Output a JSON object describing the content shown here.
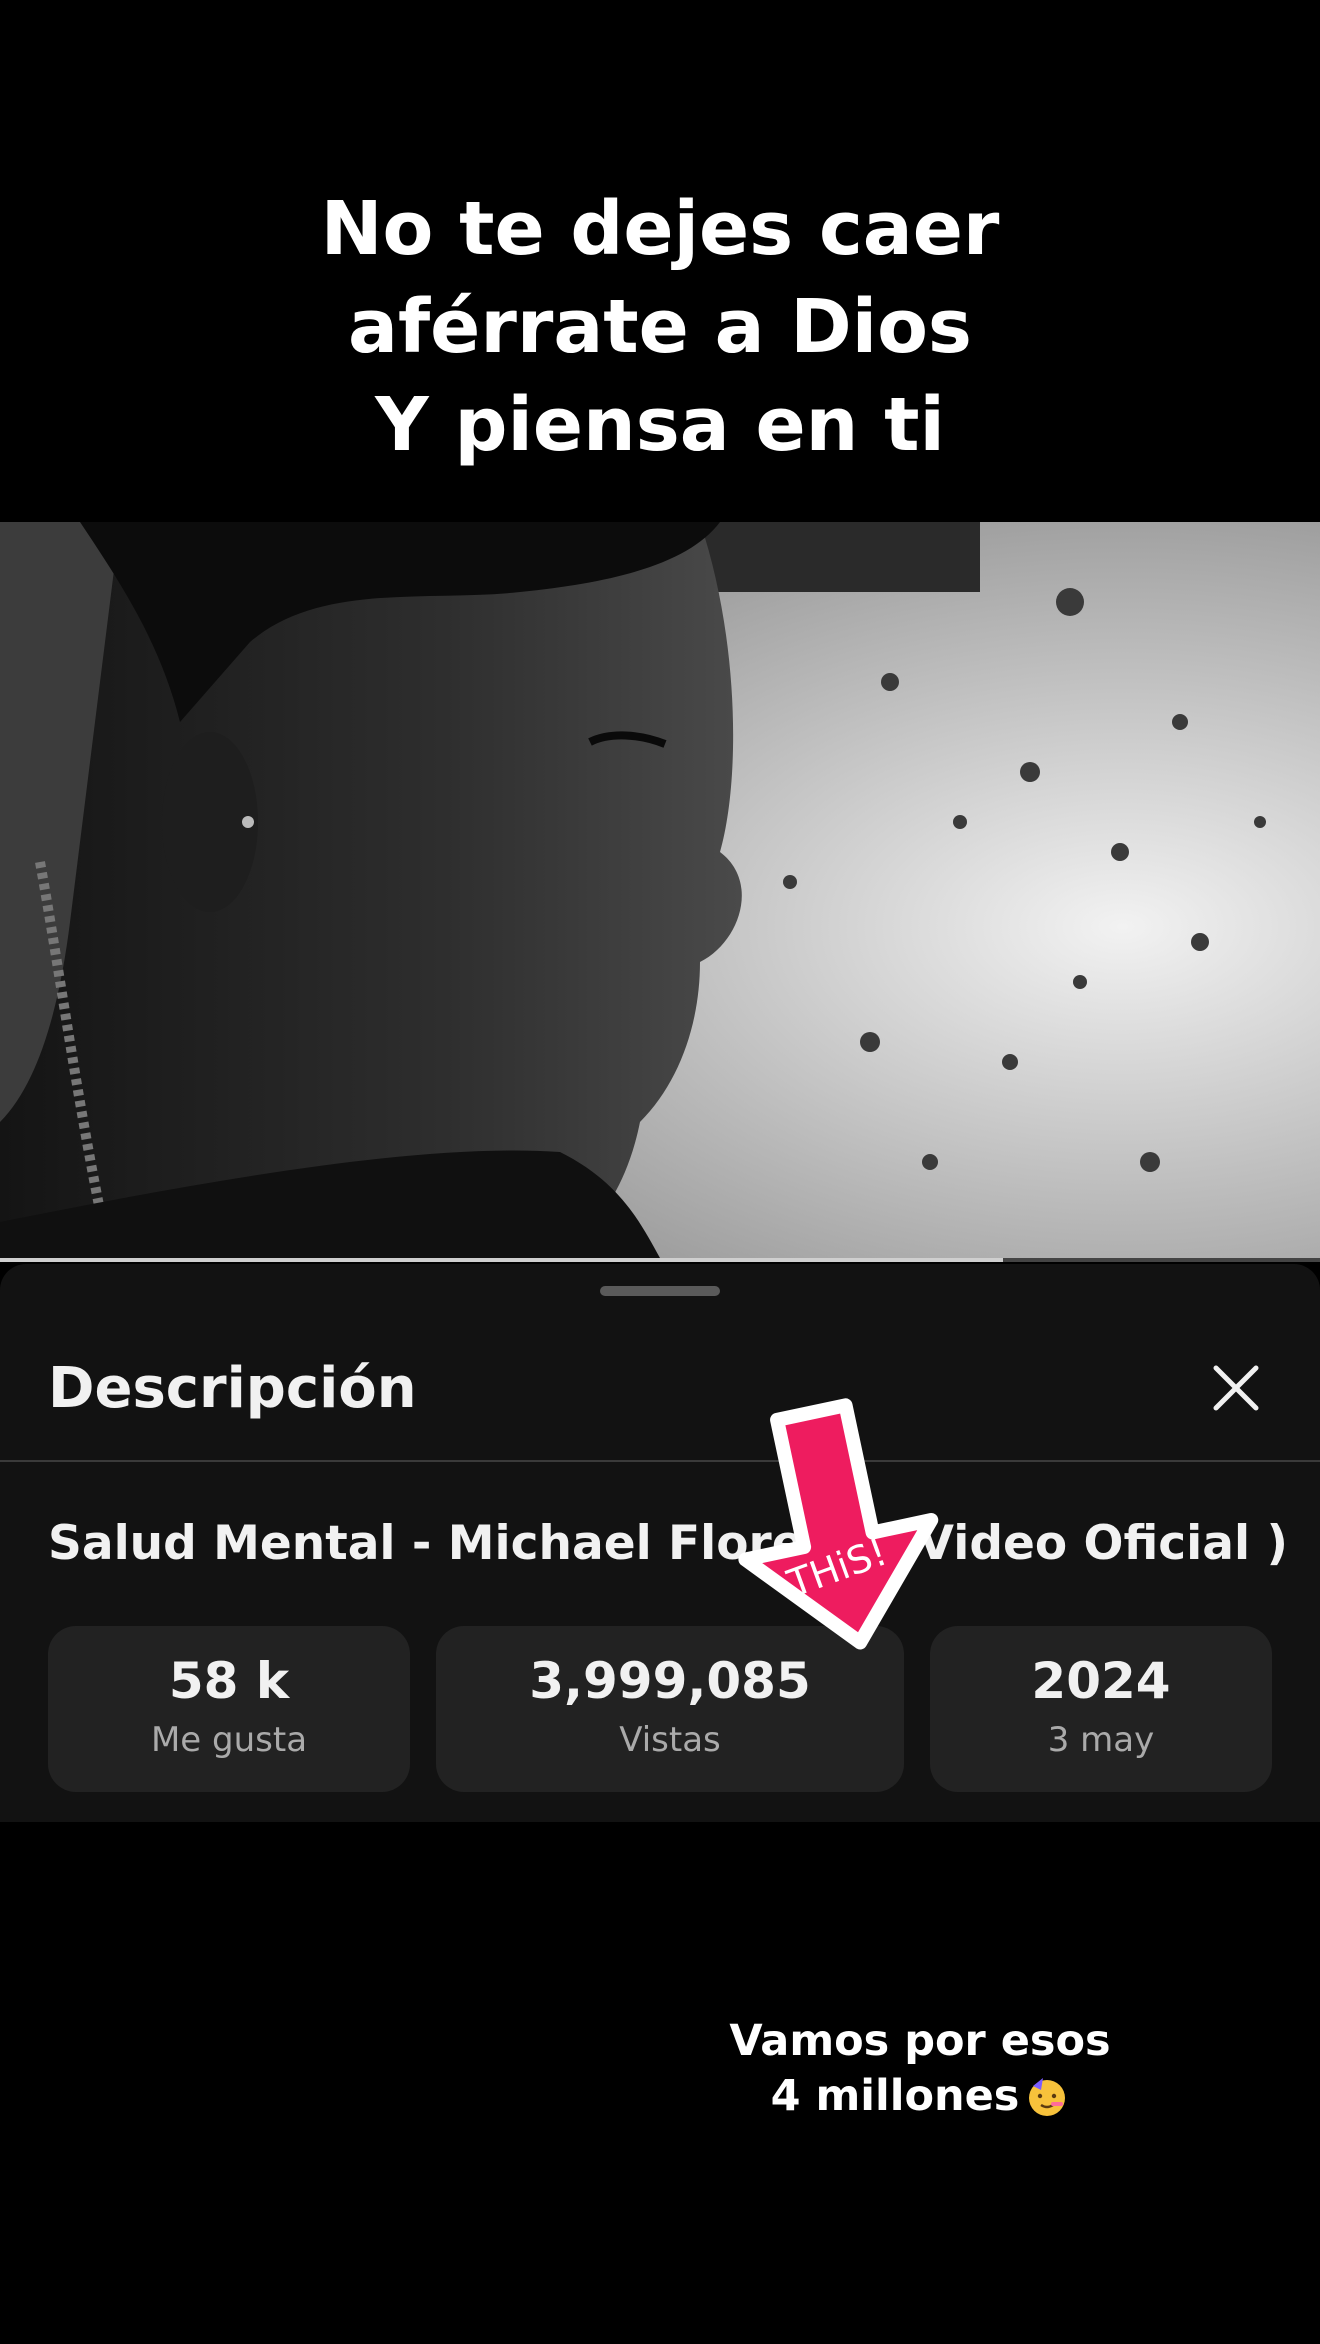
{
  "overlay_caption": {
    "lines": [
      "No te dejes caer",
      "aférrate a Dios",
      "Y piensa en ti"
    ]
  },
  "video": {
    "progress": 0.76
  },
  "description_sheet": {
    "title": "Descripción",
    "close_icon": "close-icon",
    "video_title": "Salud Mental - Michael Florees ( Video Oficial )",
    "stats": [
      {
        "value": "58 k",
        "label": "Me gusta"
      },
      {
        "value": "3,999,085",
        "label": "Vistas"
      },
      {
        "value": "2024",
        "label": "3 may"
      }
    ]
  },
  "sticker": {
    "text": "THiS!",
    "color": "#EE1C5F",
    "icon": "arrow-down-sticker-icon"
  },
  "bottom_caption": {
    "line1": "Vamos por esos",
    "line2": "4 millones",
    "emoji": "party-face-emoji-icon"
  }
}
